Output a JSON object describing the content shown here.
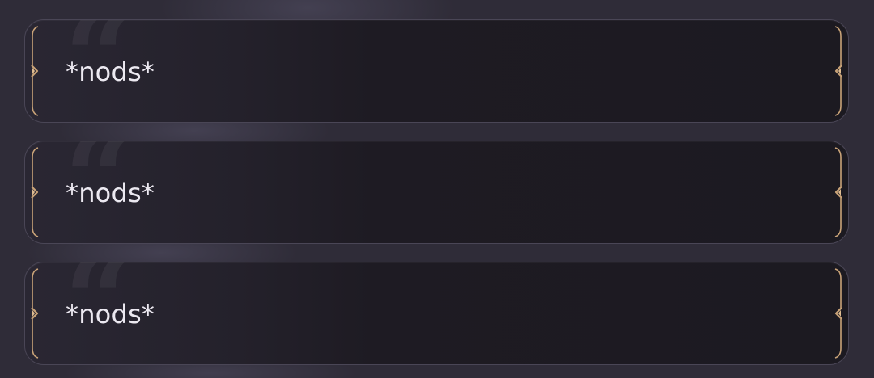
{
  "messages": [
    {
      "text": "*nods*"
    },
    {
      "text": "*nods*"
    },
    {
      "text": "*nods*"
    }
  ],
  "theme": {
    "background": "#2f2c38",
    "bubble_fill": "#1e1b23",
    "bubble_border": "#4a4656",
    "accent_gold": "#c9a378",
    "text": "#ece9f1"
  },
  "icons": {
    "quote": "open-quote-icon",
    "frame_left": "ornate-left-frame-icon",
    "frame_right": "ornate-right-frame-icon"
  }
}
